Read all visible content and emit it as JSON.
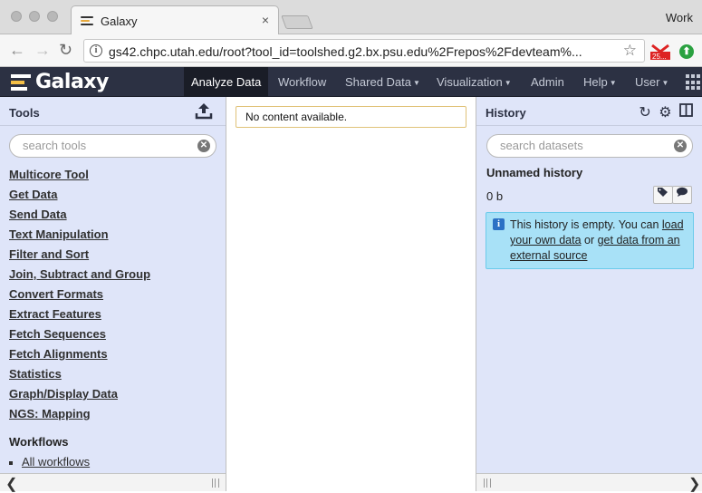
{
  "browser": {
    "tab_title": "Galaxy",
    "tab_close": "×",
    "profile": "Work",
    "url": "gs42.chpc.utah.edu/root?tool_id=toolshed.g2.bx.psu.edu%2Frepos%2Fdevteam%...",
    "ext_gmail_badge": "25...",
    "ext_green": "⬆"
  },
  "masthead": {
    "brand": "Galaxy",
    "nav": [
      {
        "label": "Analyze Data",
        "caret": ""
      },
      {
        "label": "Workflow",
        "caret": ""
      },
      {
        "label": "Shared Data",
        "caret": "▼"
      },
      {
        "label": "Visualization",
        "caret": "▼"
      },
      {
        "label": "Admin",
        "caret": ""
      },
      {
        "label": "Help",
        "caret": "▼"
      },
      {
        "label": "User",
        "caret": "▼"
      }
    ]
  },
  "tools": {
    "title": "Tools",
    "search_placeholder": "search tools",
    "sections": [
      "Multicore Tool",
      "Get Data",
      "Send Data",
      "Text Manipulation",
      "Filter and Sort",
      "Join, Subtract and Group",
      "Convert Formats",
      "Extract Features",
      "Fetch Sequences",
      "Fetch Alignments",
      "Statistics",
      "Graph/Display Data",
      "NGS: Mapping"
    ],
    "workflows_title": "Workflows",
    "workflows_link": "All workflows"
  },
  "center": {
    "message": "No content available."
  },
  "history": {
    "title": "History",
    "search_placeholder": "search datasets",
    "name": "Unnamed history",
    "size": "0 b",
    "empty_msg_1": "This history is empty. You can ",
    "empty_link_1": "load your own data",
    "empty_msg_2": " or ",
    "empty_link_2": "get data from an external source"
  }
}
